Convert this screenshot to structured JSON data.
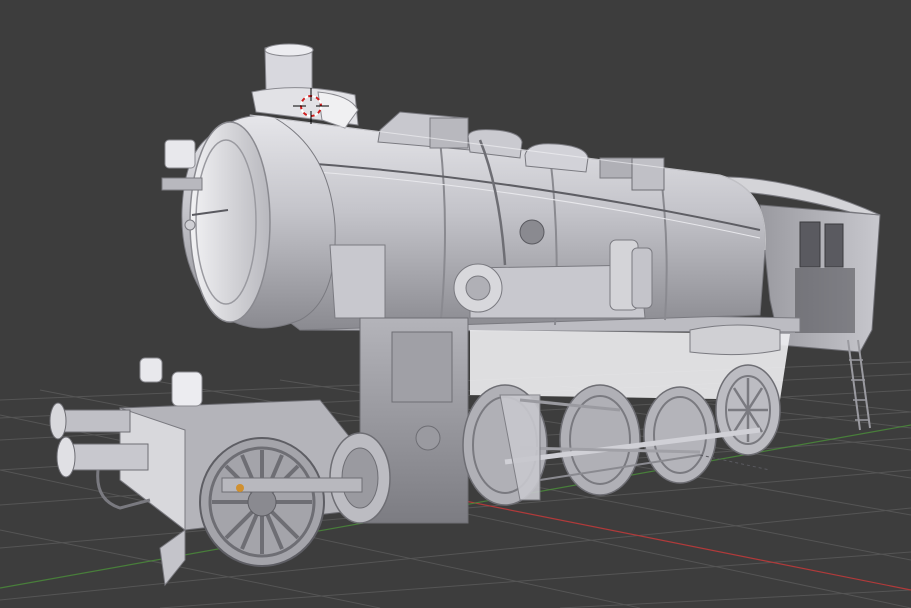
{
  "viewport": {
    "background_color": "#3d3d3d",
    "grid_color": "#555555",
    "x_axis_color": "#b03a3a",
    "y_axis_color": "#4b8f3a",
    "model_color_light": "#d8d8dc",
    "model_color_mid": "#a8a8ae",
    "model_color_dark": "#6e6e74",
    "cursor_colors": [
      "#d02020",
      "#ffffff"
    ],
    "icons": [
      "3d-cursor-icon"
    ]
  }
}
